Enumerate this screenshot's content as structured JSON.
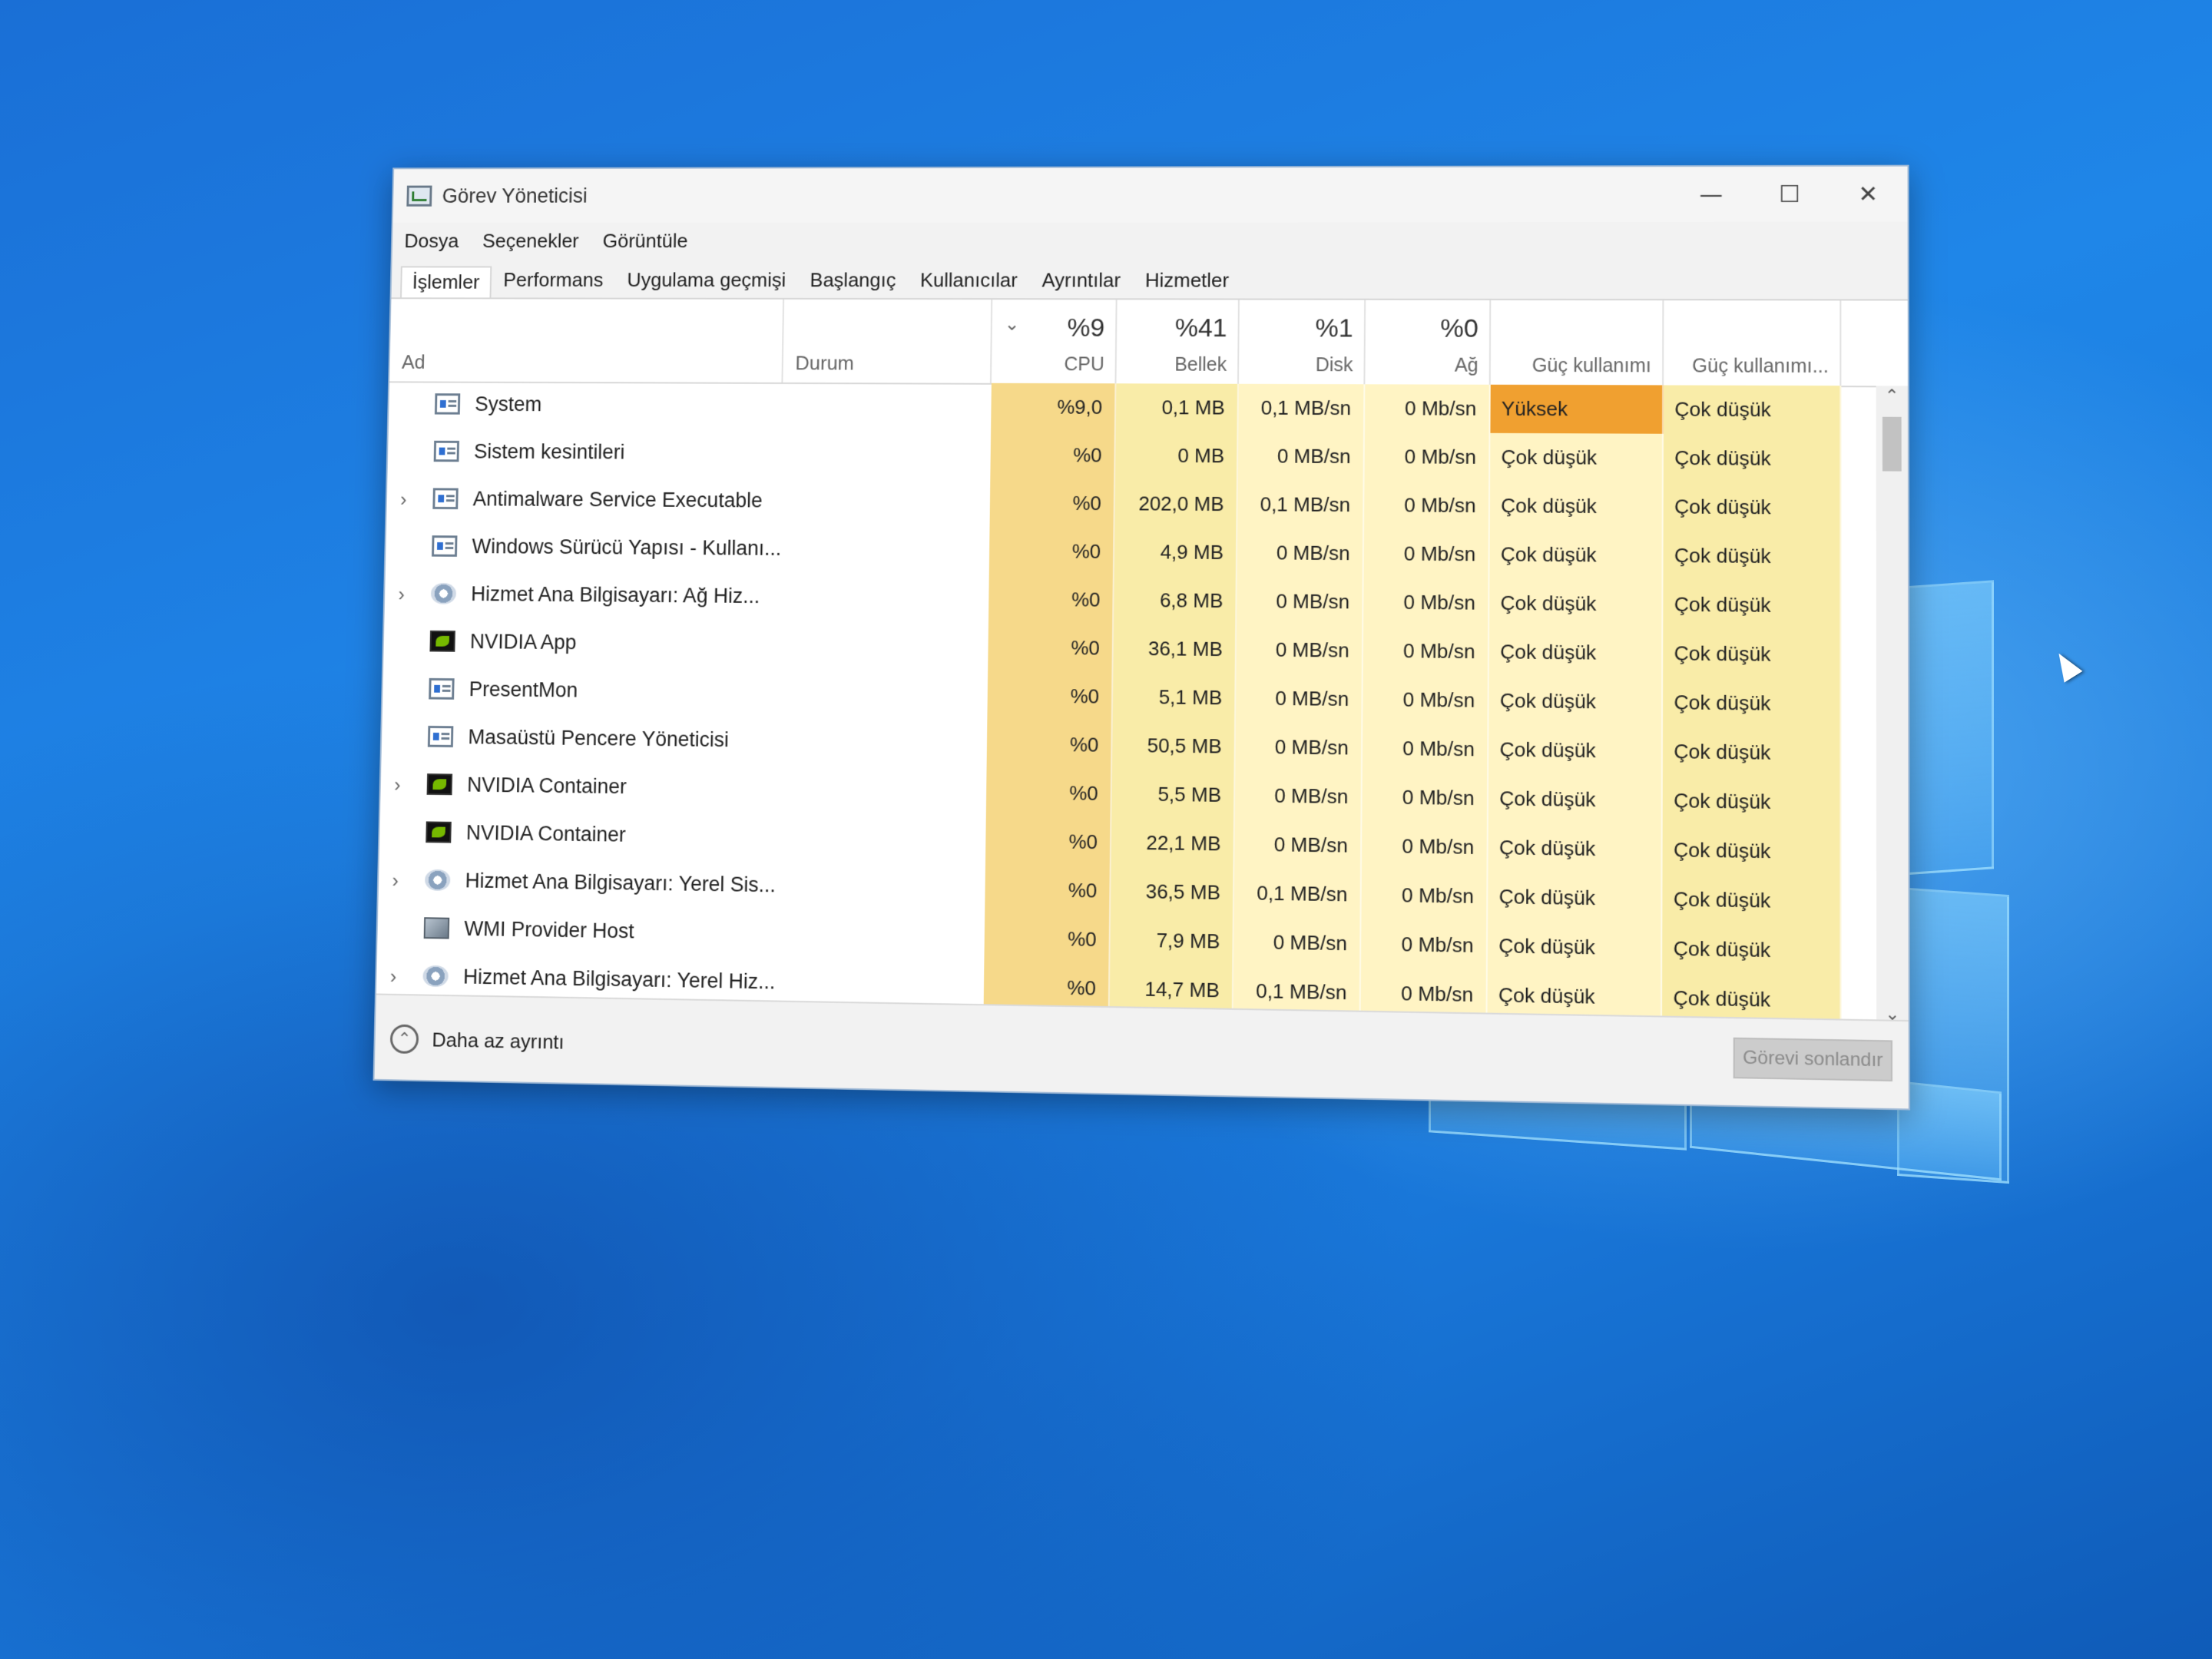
{
  "window": {
    "title": "Görev Yöneticisi",
    "controls": {
      "minimize": "—",
      "maximize": "☐",
      "close": "✕"
    }
  },
  "menu": [
    "Dosya",
    "Seçenekler",
    "Görüntüle"
  ],
  "tabs": [
    "İşlemler",
    "Performans",
    "Uygulama geçmişi",
    "Başlangıç",
    "Kullanıcılar",
    "Ayrıntılar",
    "Hizmetler"
  ],
  "active_tab": "İşlemler",
  "columns": {
    "name": "Ad",
    "status": "Durum",
    "cpu": {
      "percent": "%9",
      "label": "CPU"
    },
    "memory": {
      "percent": "%41",
      "label": "Bellek"
    },
    "disk": {
      "percent": "%1",
      "label": "Disk"
    },
    "network": {
      "percent": "%0",
      "label": "Ağ"
    },
    "power": "Güç kullanımı",
    "power_trend": "Güç kullanımı..."
  },
  "processes": [
    {
      "name": "System",
      "icon": "window-icon",
      "expandable": false,
      "cpu": "%9,0",
      "memory": "0,1 MB",
      "disk": "0,1 MB/sn",
      "network": "0 Mb/sn",
      "power": "Yüksek",
      "power_trend": "Çok düşük"
    },
    {
      "name": "Sistem kesintileri",
      "icon": "window-icon",
      "expandable": false,
      "cpu": "%0",
      "memory": "0 MB",
      "disk": "0 MB/sn",
      "network": "0 Mb/sn",
      "power": "Çok düşük",
      "power_trend": "Çok düşük"
    },
    {
      "name": "Antimalware Service Executable",
      "icon": "window-icon",
      "expandable": true,
      "cpu": "%0",
      "memory": "202,0 MB",
      "disk": "0,1 MB/sn",
      "network": "0 Mb/sn",
      "power": "Çok düşük",
      "power_trend": "Çok düşük"
    },
    {
      "name": "Windows Sürücü Yapısı - Kullanı...",
      "icon": "window-icon",
      "expandable": false,
      "cpu": "%0",
      "memory": "4,9 MB",
      "disk": "0 MB/sn",
      "network": "0 Mb/sn",
      "power": "Çok düşük",
      "power_trend": "Çok düşük"
    },
    {
      "name": "Hizmet Ana Bilgisayarı: Ağ Hiz...",
      "icon": "gear-icon",
      "expandable": true,
      "cpu": "%0",
      "memory": "6,8 MB",
      "disk": "0 MB/sn",
      "network": "0 Mb/sn",
      "power": "Çok düşük",
      "power_trend": "Çok düşük"
    },
    {
      "name": "NVIDIA App",
      "icon": "nvidia-icon",
      "expandable": false,
      "cpu": "%0",
      "memory": "36,1 MB",
      "disk": "0 MB/sn",
      "network": "0 Mb/sn",
      "power": "Çok düşük",
      "power_trend": "Çok düşük"
    },
    {
      "name": "PresentMon",
      "icon": "window-icon",
      "expandable": false,
      "cpu": "%0",
      "memory": "5,1 MB",
      "disk": "0 MB/sn",
      "network": "0 Mb/sn",
      "power": "Çok düşük",
      "power_trend": "Çok düşük"
    },
    {
      "name": "Masaüstü Pencere Yöneticisi",
      "icon": "window-icon",
      "expandable": false,
      "cpu": "%0",
      "memory": "50,5 MB",
      "disk": "0 MB/sn",
      "network": "0 Mb/sn",
      "power": "Çok düşük",
      "power_trend": "Çok düşük"
    },
    {
      "name": "NVIDIA Container",
      "icon": "nvidia-icon",
      "expandable": true,
      "cpu": "%0",
      "memory": "5,5 MB",
      "disk": "0 MB/sn",
      "network": "0 Mb/sn",
      "power": "Çok düşük",
      "power_trend": "Çok düşük"
    },
    {
      "name": "NVIDIA Container",
      "icon": "nvidia-icon",
      "expandable": false,
      "cpu": "%0",
      "memory": "22,1 MB",
      "disk": "0 MB/sn",
      "network": "0 Mb/sn",
      "power": "Çok düşük",
      "power_trend": "Çok düşük"
    },
    {
      "name": "Hizmet Ana Bilgisayarı: Yerel Sis...",
      "icon": "gear-icon",
      "expandable": true,
      "cpu": "%0",
      "memory": "36,5 MB",
      "disk": "0,1 MB/sn",
      "network": "0 Mb/sn",
      "power": "Çok düşük",
      "power_trend": "Çok düşük"
    },
    {
      "name": "WMI Provider Host",
      "icon": "wmi-icon",
      "expandable": false,
      "cpu": "%0",
      "memory": "7,9 MB",
      "disk": "0 MB/sn",
      "network": "0 Mb/sn",
      "power": "Çok düşük",
      "power_trend": "Çok düşük"
    },
    {
      "name": "Hizmet Ana Bilgisayarı: Yerel Hiz...",
      "icon": "gear-icon",
      "expandable": true,
      "cpu": "%0",
      "memory": "14,7 MB",
      "disk": "0,1 MB/sn",
      "network": "0 Mb/sn",
      "power": "Çok düşük",
      "power_trend": "Çok düşük"
    }
  ],
  "footer": {
    "less_details": "Daha az ayrıntı",
    "end_task": "Görevi sonlandır"
  },
  "colors": {
    "heat_low": "#fff4c4",
    "heat_mid": "#f9eca8",
    "heat_high": "#f6d98a",
    "power_high": "#f0a030"
  }
}
